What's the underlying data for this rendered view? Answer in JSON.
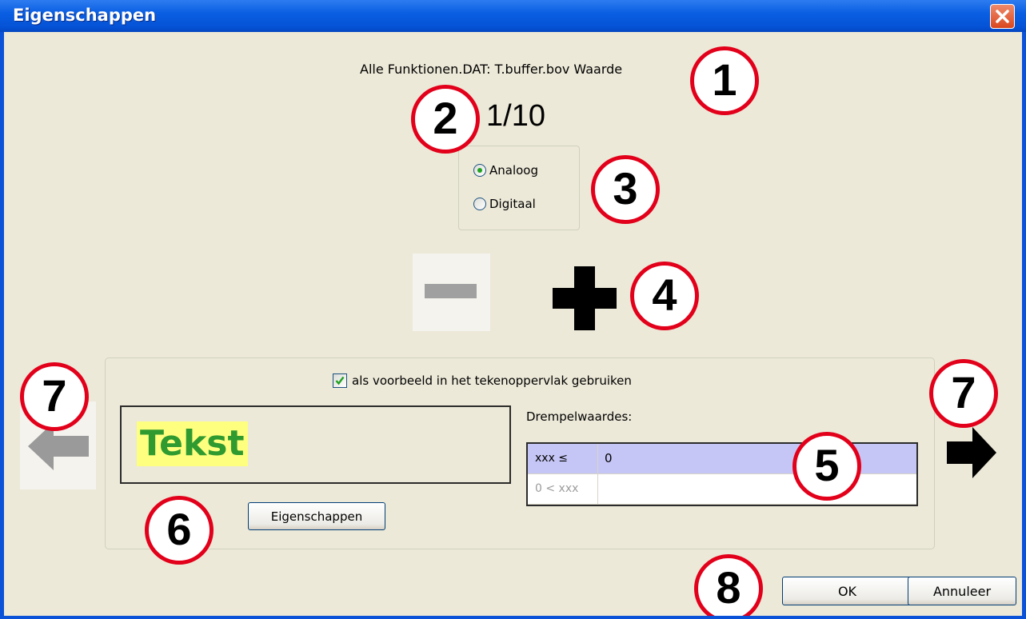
{
  "window": {
    "title": "Eigenschappen"
  },
  "header": {
    "text": "Alle Funktionen.DAT: T.buffer.bov Waarde",
    "counter": "1/10"
  },
  "mode": {
    "options": [
      {
        "label": "Analoog",
        "selected": true
      },
      {
        "label": "Digitaal",
        "selected": false
      }
    ]
  },
  "use_as_example": {
    "label": "als voorbeeld in het tekenoppervlak gebruiken",
    "checked": true
  },
  "preview": {
    "text": "Tekst",
    "text_color": "#2f9a2f",
    "highlight_color": "#ffff7f"
  },
  "properties_button": {
    "label": "Eigenschappen"
  },
  "thresholds": {
    "label": "Drempelwaardes:",
    "rows": [
      {
        "condition": "xxx ≤",
        "value": "0",
        "selected": true
      },
      {
        "condition": "0 < xxx",
        "value": "",
        "selected": false
      }
    ]
  },
  "buttons": {
    "ok": "OK",
    "cancel": "Annuleer"
  },
  "callouts": [
    "1",
    "2",
    "3",
    "4",
    "5",
    "6",
    "7",
    "7",
    "8"
  ],
  "colors": {
    "titlebar": "#0552d6",
    "dialog_bg": "#ece9d8",
    "callout_ring": "#e2001a",
    "selected_row": "#c6c6f6"
  }
}
